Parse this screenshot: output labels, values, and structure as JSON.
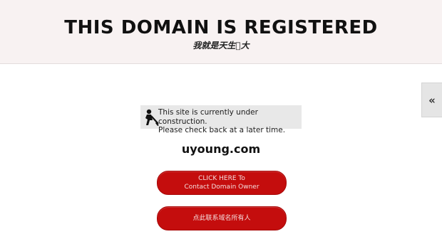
{
  "header": {
    "title": "THIS DOMAIN IS REGISTERED",
    "subtitle": "我就是天生𠓰大"
  },
  "side_tab": {
    "label": "«"
  },
  "notice": {
    "icon": "construction-worker-icon",
    "line1": "This site is currently under construction.",
    "line2": "Please check back at a later time."
  },
  "domain": "uyoung.com",
  "buttons": {
    "contact_line1": "CLICK HERE To",
    "contact_line2": "Contact Domain Owner",
    "contact_cn": "点此联系域名所有人"
  },
  "colors": {
    "header_bg": "#f8f2f2",
    "button_red": "#c40d0d",
    "notice_bg": "#e8e8e8"
  }
}
